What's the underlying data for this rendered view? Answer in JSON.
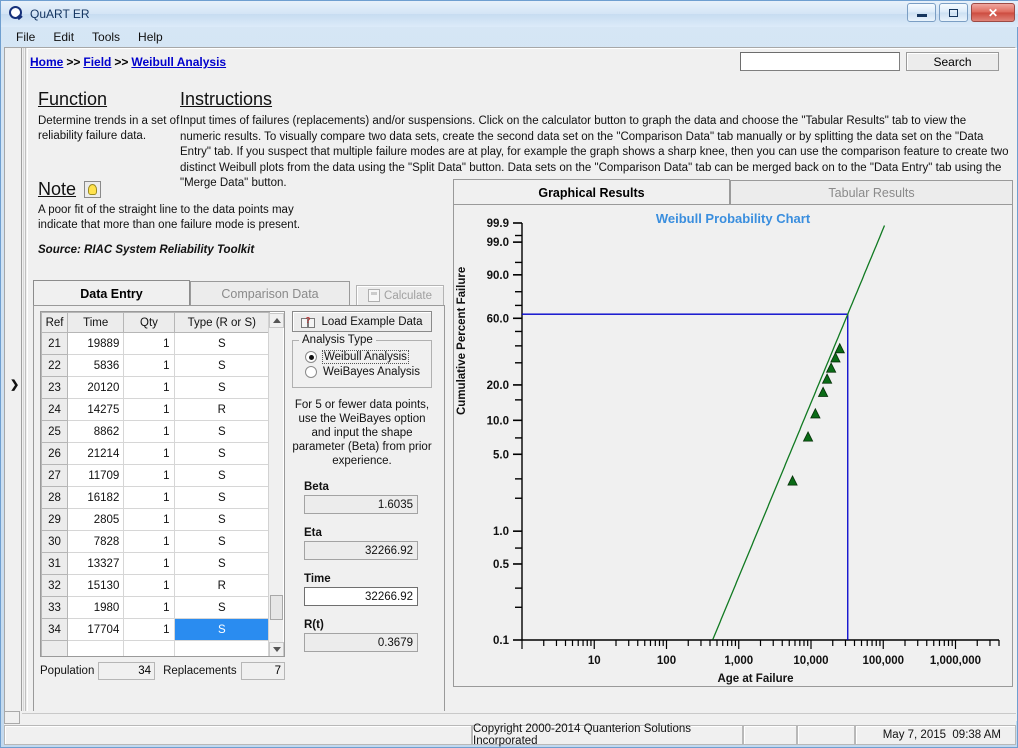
{
  "window": {
    "title": "QuART ER",
    "icon": "app-q-icon",
    "buttons": {
      "minimize": "minimize",
      "maximize": "maximize",
      "close": "close"
    }
  },
  "menu": {
    "items": [
      "File",
      "Edit",
      "Tools",
      "Help"
    ]
  },
  "breadcrumb": {
    "items": [
      "Home",
      "Field",
      "Weibull Analysis"
    ],
    "separator": ">>"
  },
  "search": {
    "value": "",
    "placeholder": "",
    "button_label": "Search"
  },
  "function": {
    "heading": "Function",
    "body": "Determine trends in a set of reliability failure data."
  },
  "instructions": {
    "heading": "Instructions",
    "body": "Input times of failures (replacements) and/or suspensions. Click on the calculator button to graph the data and choose the \"Tabular Results\" tab to  view the numeric results. To visually compare two data sets, create the second data set on the \"Comparison Data\" tab manually or by splitting the data set on the \"Data Entry\" tab. If you suspect that multiple failure modes are at play, for example the graph shows a sharp knee, then you can use the comparison feature to create two distinct Weibull plots from the data using the \"Split Data\" button. Data sets on the \"Comparison Data\" tab can be merged back on to the \"Data Entry\" tab using the \"Merge Data\" button."
  },
  "note": {
    "heading": "Note",
    "body": "A poor fit of the straight line to the data points may indicate that more than one failure mode is present.",
    "source": "Source: RIAC System Reliability Toolkit"
  },
  "left_panel": {
    "tabs": [
      {
        "label": "Data Entry",
        "active": true
      },
      {
        "label": "Comparison Data",
        "active": false
      }
    ],
    "calculate_label": "Calculate",
    "table": {
      "columns": [
        "Ref",
        "Time",
        "Qty",
        "Type (R or S)"
      ],
      "rows": [
        {
          "ref": "21",
          "time": "19889",
          "qty": "1",
          "type": "S",
          "selected": false
        },
        {
          "ref": "22",
          "time": "5836",
          "qty": "1",
          "type": "S",
          "selected": false
        },
        {
          "ref": "23",
          "time": "20120",
          "qty": "1",
          "type": "S",
          "selected": false
        },
        {
          "ref": "24",
          "time": "14275",
          "qty": "1",
          "type": "R",
          "selected": false
        },
        {
          "ref": "25",
          "time": "8862",
          "qty": "1",
          "type": "S",
          "selected": false
        },
        {
          "ref": "26",
          "time": "21214",
          "qty": "1",
          "type": "S",
          "selected": false
        },
        {
          "ref": "27",
          "time": "11709",
          "qty": "1",
          "type": "S",
          "selected": false
        },
        {
          "ref": "28",
          "time": "16182",
          "qty": "1",
          "type": "S",
          "selected": false
        },
        {
          "ref": "29",
          "time": "2805",
          "qty": "1",
          "type": "S",
          "selected": false
        },
        {
          "ref": "30",
          "time": "7828",
          "qty": "1",
          "type": "S",
          "selected": false
        },
        {
          "ref": "31",
          "time": "13327",
          "qty": "1",
          "type": "S",
          "selected": false
        },
        {
          "ref": "32",
          "time": "15130",
          "qty": "1",
          "type": "R",
          "selected": false
        },
        {
          "ref": "33",
          "time": "1980",
          "qty": "1",
          "type": "S",
          "selected": false
        },
        {
          "ref": "34",
          "time": "17704",
          "qty": "1",
          "type": "S",
          "selected": true
        },
        {
          "ref": "",
          "time": "",
          "qty": "",
          "type": "",
          "selected": false
        }
      ]
    },
    "population": {
      "label": "Population",
      "value": "34"
    },
    "replacements": {
      "label": "Replacements",
      "value": "7"
    },
    "load_example_label": "Load Example Data",
    "analysis_type": {
      "legend": "Analysis Type",
      "options": [
        {
          "label": "Weibull Analysis",
          "selected": true
        },
        {
          "label": "WeiBayes Analysis",
          "selected": false
        }
      ]
    },
    "hint": "For 5 or fewer data points, use the WeiBayes option and input the shape parameter (Beta) from prior experience.",
    "results": [
      {
        "label": "Beta",
        "value": "1.6035",
        "editable": false
      },
      {
        "label": "Eta",
        "value": "32266.92",
        "editable": false
      },
      {
        "label": "Time",
        "value": "32266.92",
        "editable": true
      },
      {
        "label": "R(t)",
        "value": "0.3679",
        "editable": false
      }
    ]
  },
  "right_panel": {
    "tabs": [
      {
        "label": "Graphical Results",
        "active": true
      },
      {
        "label": "Tabular Results",
        "active": false
      }
    ]
  },
  "chart_data": {
    "type": "scatter",
    "title": "Weibull Probability Chart",
    "xlabel": "Age at Failure",
    "ylabel": "Cumulative Percent Failure",
    "title_color": "#3a8ede",
    "point_color": "#0a6b16",
    "fit_line_color": "#117a22",
    "marker_line_color": "#0000cc",
    "x_scale": "log10",
    "x_ticks": [
      10,
      100,
      1000,
      10000,
      100000,
      1000000
    ],
    "x_tick_labels": [
      "10",
      "100",
      "1,000",
      "10,000",
      "100,000",
      "1,000,000"
    ],
    "xlim": [
      1,
      4000000
    ],
    "y_scale": "weibull",
    "y_ticks": [
      99.9,
      99.0,
      90.0,
      60.0,
      20.0,
      10.0,
      5.0,
      1.0,
      0.5,
      0.1
    ],
    "y_tick_labels": [
      "99.9",
      "99.0",
      "90.0",
      "60.0",
      "20.0",
      "10.0",
      "5.0",
      "1.0",
      "0.5",
      "0.1"
    ],
    "ylim": [
      0.1,
      99.9
    ],
    "grid": false,
    "legend": "none",
    "points": [
      {
        "x": 5550,
        "y": 2.9
      },
      {
        "x": 9100,
        "y": 7.2
      },
      {
        "x": 11500,
        "y": 11.5
      },
      {
        "x": 14700,
        "y": 17.5
      },
      {
        "x": 16700,
        "y": 22.5
      },
      {
        "x": 19000,
        "y": 27.5
      },
      {
        "x": 21800,
        "y": 33.0
      },
      {
        "x": 25000,
        "y": 38.5
      }
    ],
    "fit_line": {
      "beta": 1.6035,
      "eta": 32266.92
    },
    "markers": {
      "horizontal_percent": 63.2,
      "vertical_time": 32266.92,
      "description": "Blue crosshair at Eta showing 63.2% cumulative failure"
    }
  },
  "status_bar": {
    "copyright": "Copyright 2000-2014 Quanterion Solutions Incorporated",
    "date": "May 7, 2015",
    "time": "09:38 AM",
    "cell1": "",
    "cell3": "",
    "cell4": ""
  }
}
